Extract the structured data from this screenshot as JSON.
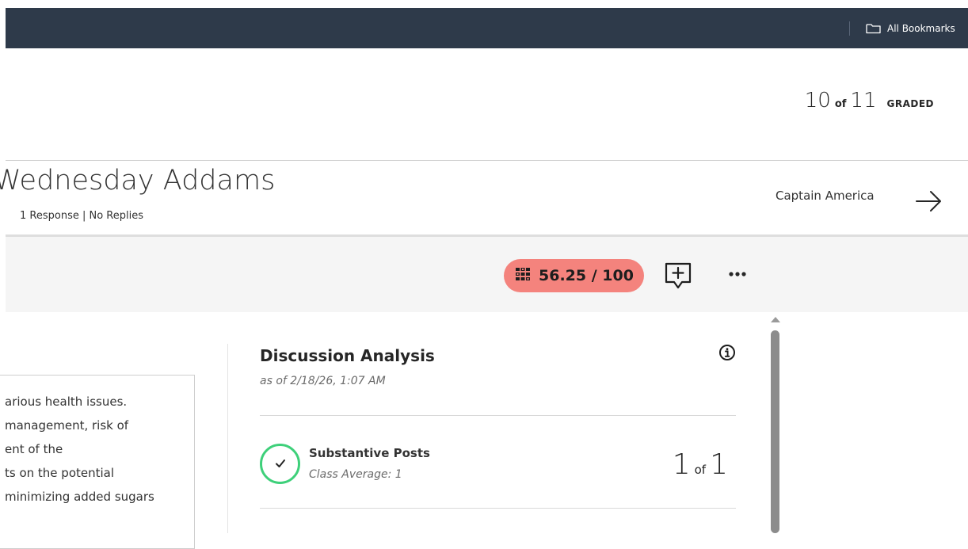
{
  "browser": {
    "bookmarks_label": "All Bookmarks"
  },
  "grading": {
    "graded_current": "10",
    "graded_of": "of",
    "graded_total": "11",
    "graded_label": "GRADED"
  },
  "student": {
    "name": "Wednesday Addams",
    "meta": "1 Response | No Replies",
    "next_student": "Captain America"
  },
  "toolbar": {
    "grade": "56.25 / 100",
    "accent_color": "#f4837d"
  },
  "post": {
    "lines": [
      "arious health issues.",
      "management, risk of",
      "ent of the",
      "ts on the potential",
      "minimizing added sugars"
    ]
  },
  "analysis": {
    "title": "Discussion Analysis",
    "date": "as of 2/18/26, 1:07 AM",
    "metrics": [
      {
        "label": "Substantive Posts",
        "sub": "Class Average: 1",
        "value": "1",
        "of": "of",
        "total": "1",
        "status_color": "#3ed07a"
      }
    ]
  }
}
